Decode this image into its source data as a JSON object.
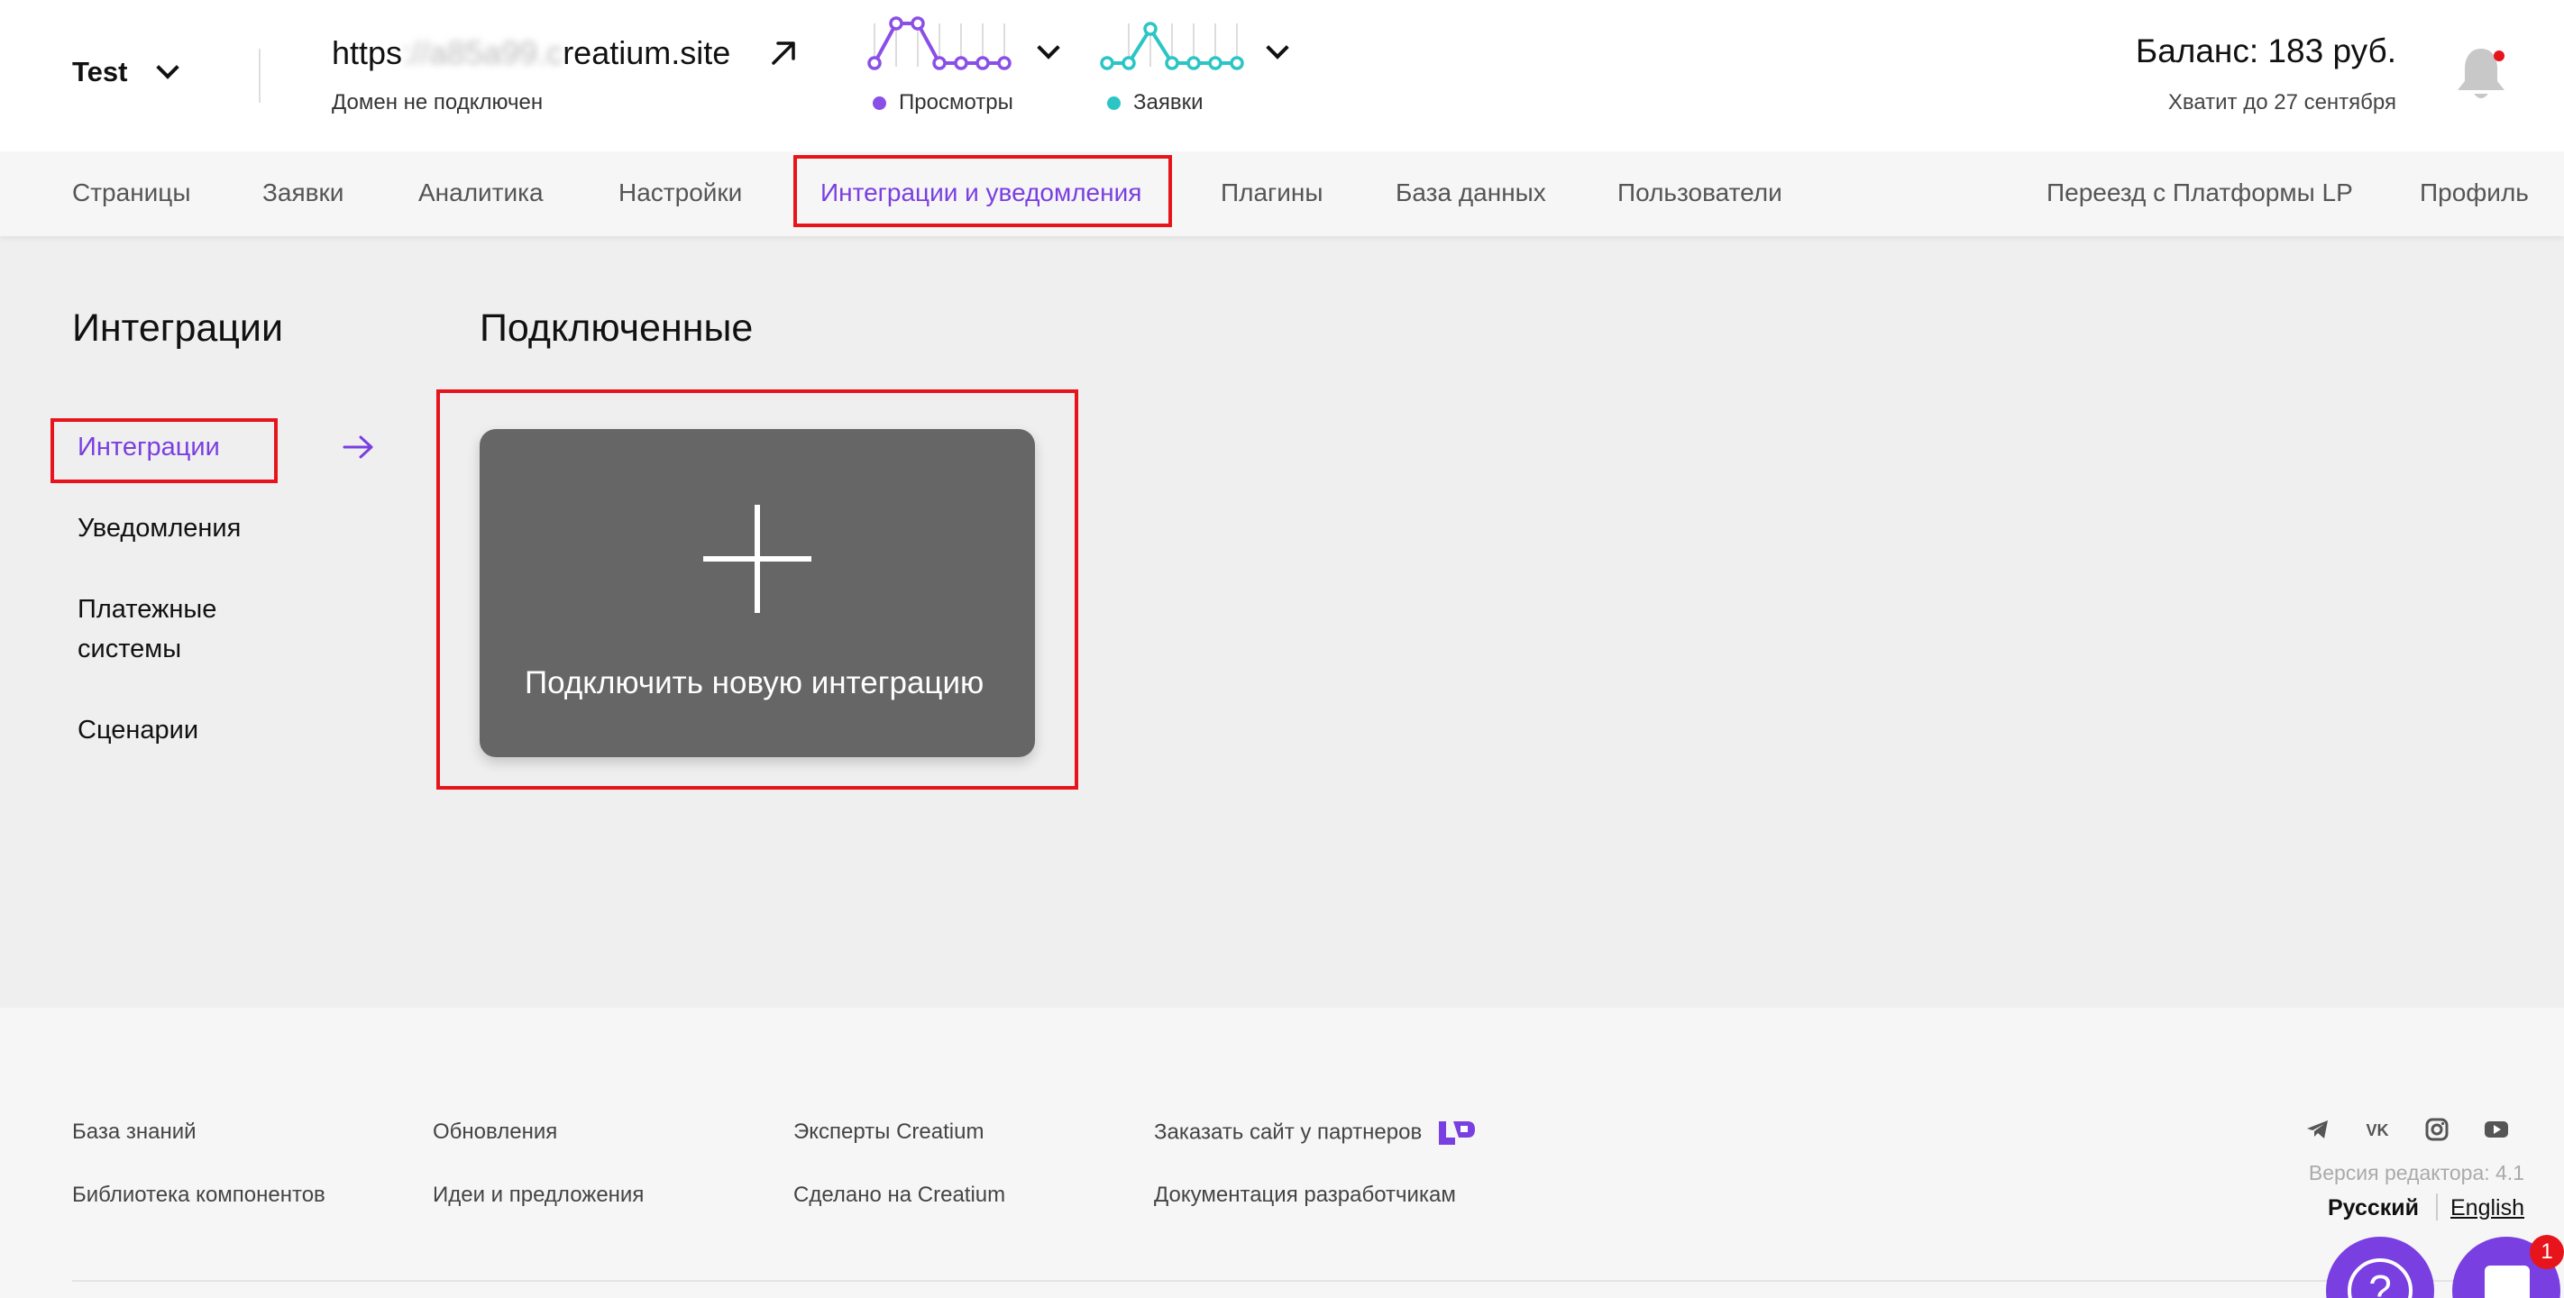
{
  "header": {
    "project_name": "Test",
    "domain_prefix": "https",
    "domain_blurred": "://a85a99.c",
    "domain_suffix": "reatium.site",
    "domain_status": "Домен не подключен",
    "views_label": "Просмотры",
    "leads_label": "Заявки",
    "balance": "Баланс: 183 руб.",
    "balance_note": "Хватит до 27 сентября",
    "colors": {
      "views": "#8a4fe6",
      "leads": "#2cc5c5"
    }
  },
  "nav": {
    "items": [
      {
        "label": "Страницы"
      },
      {
        "label": "Заявки"
      },
      {
        "label": "Аналитика"
      },
      {
        "label": "Настройки"
      },
      {
        "label": "Интеграции и уведомления",
        "active": true
      },
      {
        "label": "Плагины"
      },
      {
        "label": "База данных"
      },
      {
        "label": "Пользователи"
      }
    ],
    "right": [
      {
        "label": "Переезд с Платформы LP"
      },
      {
        "label": "Профиль"
      }
    ]
  },
  "sidebar": {
    "title": "Интеграции",
    "items": [
      {
        "label": "Интеграции",
        "active": true
      },
      {
        "label": "Уведомления"
      },
      {
        "label": "Платежные\nсистемы"
      },
      {
        "label": "Сценарии"
      }
    ]
  },
  "main": {
    "title": "Подключенные",
    "card_label": "Подключить новую интеграцию"
  },
  "footer": {
    "col1": [
      "База знаний",
      "Библиотека компонентов"
    ],
    "col2": [
      "Обновления",
      "Идеи и предложения"
    ],
    "col3": [
      "Эксперты Creatium",
      "Сделано на Creatium"
    ],
    "col4": [
      "Заказать сайт у партнеров",
      "Документация разработчикам"
    ],
    "version": "Версия редактора: 4.1",
    "lang_ru": "Русский",
    "lang_en": "English",
    "help_symbol": "?",
    "chat_badge": "1"
  }
}
